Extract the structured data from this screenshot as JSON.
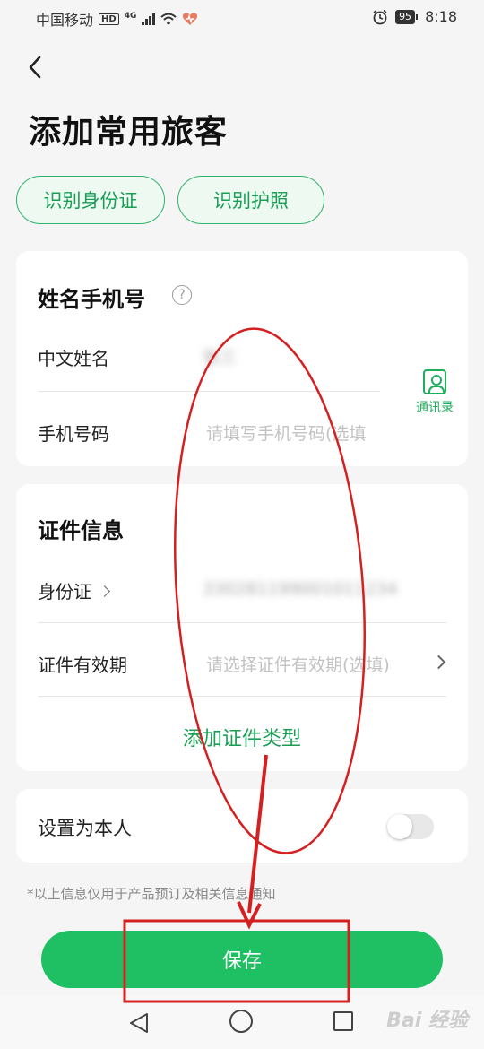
{
  "status_bar": {
    "carrier": "中国移动",
    "hd": "HD",
    "network": "4G",
    "battery": "95",
    "time": "8:18"
  },
  "page": {
    "title": "添加常用旅客"
  },
  "quick_actions": {
    "id_card": "识别身份证",
    "passport": "识别护照"
  },
  "name_phone_section": {
    "title": "姓名手机号",
    "help": "?",
    "name_label": "中文姓名",
    "name_value": "张三",
    "phone_label": "手机号码",
    "phone_placeholder": "请填写手机号码(选填",
    "contacts_label": "通讯录"
  },
  "document_section": {
    "title": "证件信息",
    "id_label": "身份证",
    "id_value": "330281199001011234",
    "validity_label": "证件有效期",
    "validity_placeholder": "请选择证件有效期(选填)",
    "add_type": "添加证件类型"
  },
  "self_section": {
    "label": "设置为本人",
    "toggle_on": false
  },
  "notice": "*以上信息仅用于产品预订及相关信息通知",
  "save_label": "保存",
  "watermark": "Bai 经验",
  "colors": {
    "accent": "#1fbf64",
    "accent_text": "#1a9e56",
    "annotation_red": "#d42020"
  }
}
